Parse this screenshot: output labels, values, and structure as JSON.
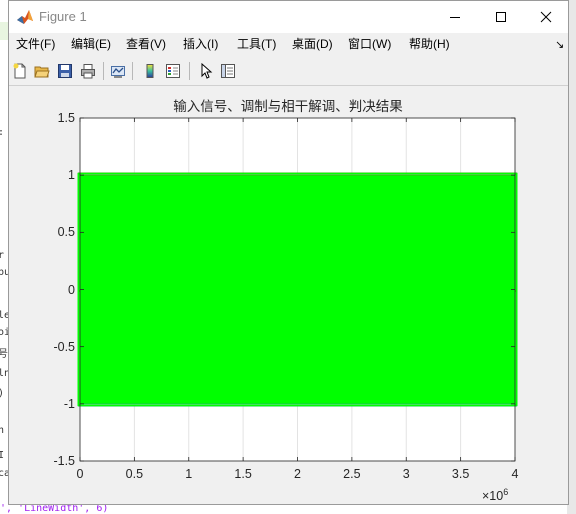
{
  "window": {
    "title": "Figure 1"
  },
  "menu": [
    {
      "label": "文件(F)"
    },
    {
      "label": "编辑(E)"
    },
    {
      "label": "查看(V)"
    },
    {
      "label": "插入(I)"
    },
    {
      "label": "工具(T)"
    },
    {
      "label": "桌面(D)"
    },
    {
      "label": "窗口(W)"
    },
    {
      "label": "帮助(H)"
    }
  ],
  "toolbar": {
    "icons": [
      "new-figure-icon",
      "open-file-icon",
      "save-icon",
      "print-icon",
      "link-plot-icon",
      "insert-colorbar-icon",
      "insert-legend-icon",
      "edit-plot-icon",
      "property-inspector-icon"
    ]
  },
  "background": {
    "fragments": [
      ":",
      "r",
      "bu",
      "le",
      "oi",
      "号",
      "ln",
      ")",
      "n",
      "I",
      "ca"
    ],
    "bottom_code": "', 'LineWidth', 6)"
  },
  "chart_data": {
    "type": "line",
    "title": "输入信号、调制与相干解调、判决结果",
    "xlabel": "",
    "ylabel": "",
    "xlim": [
      0,
      4000000
    ],
    "ylim": [
      -1.5,
      1.5
    ],
    "x_exponent_label": "×10",
    "x_exponent": "6",
    "x_tick_labels": [
      "0",
      "0.5",
      "1",
      "1.5",
      "2",
      "2.5",
      "3",
      "3.5",
      "4"
    ],
    "y_tick_labels": [
      "1.5",
      "1",
      "0.5",
      "0",
      "-0.5",
      "-1",
      "-1.5"
    ],
    "grid": true,
    "series": [
      {
        "color": "#0000ff",
        "y_min": -1,
        "y_max": 1,
        "x_start": 0,
        "x_end": 4000000
      },
      {
        "color": "#ff0000",
        "y_min": 0,
        "y_max": 1,
        "x_start": 0,
        "x_end": 4000000
      },
      {
        "color": "#00ff00",
        "y_min": -1,
        "y_max": 1,
        "x_start": 0,
        "x_end": 4000000
      }
    ]
  }
}
